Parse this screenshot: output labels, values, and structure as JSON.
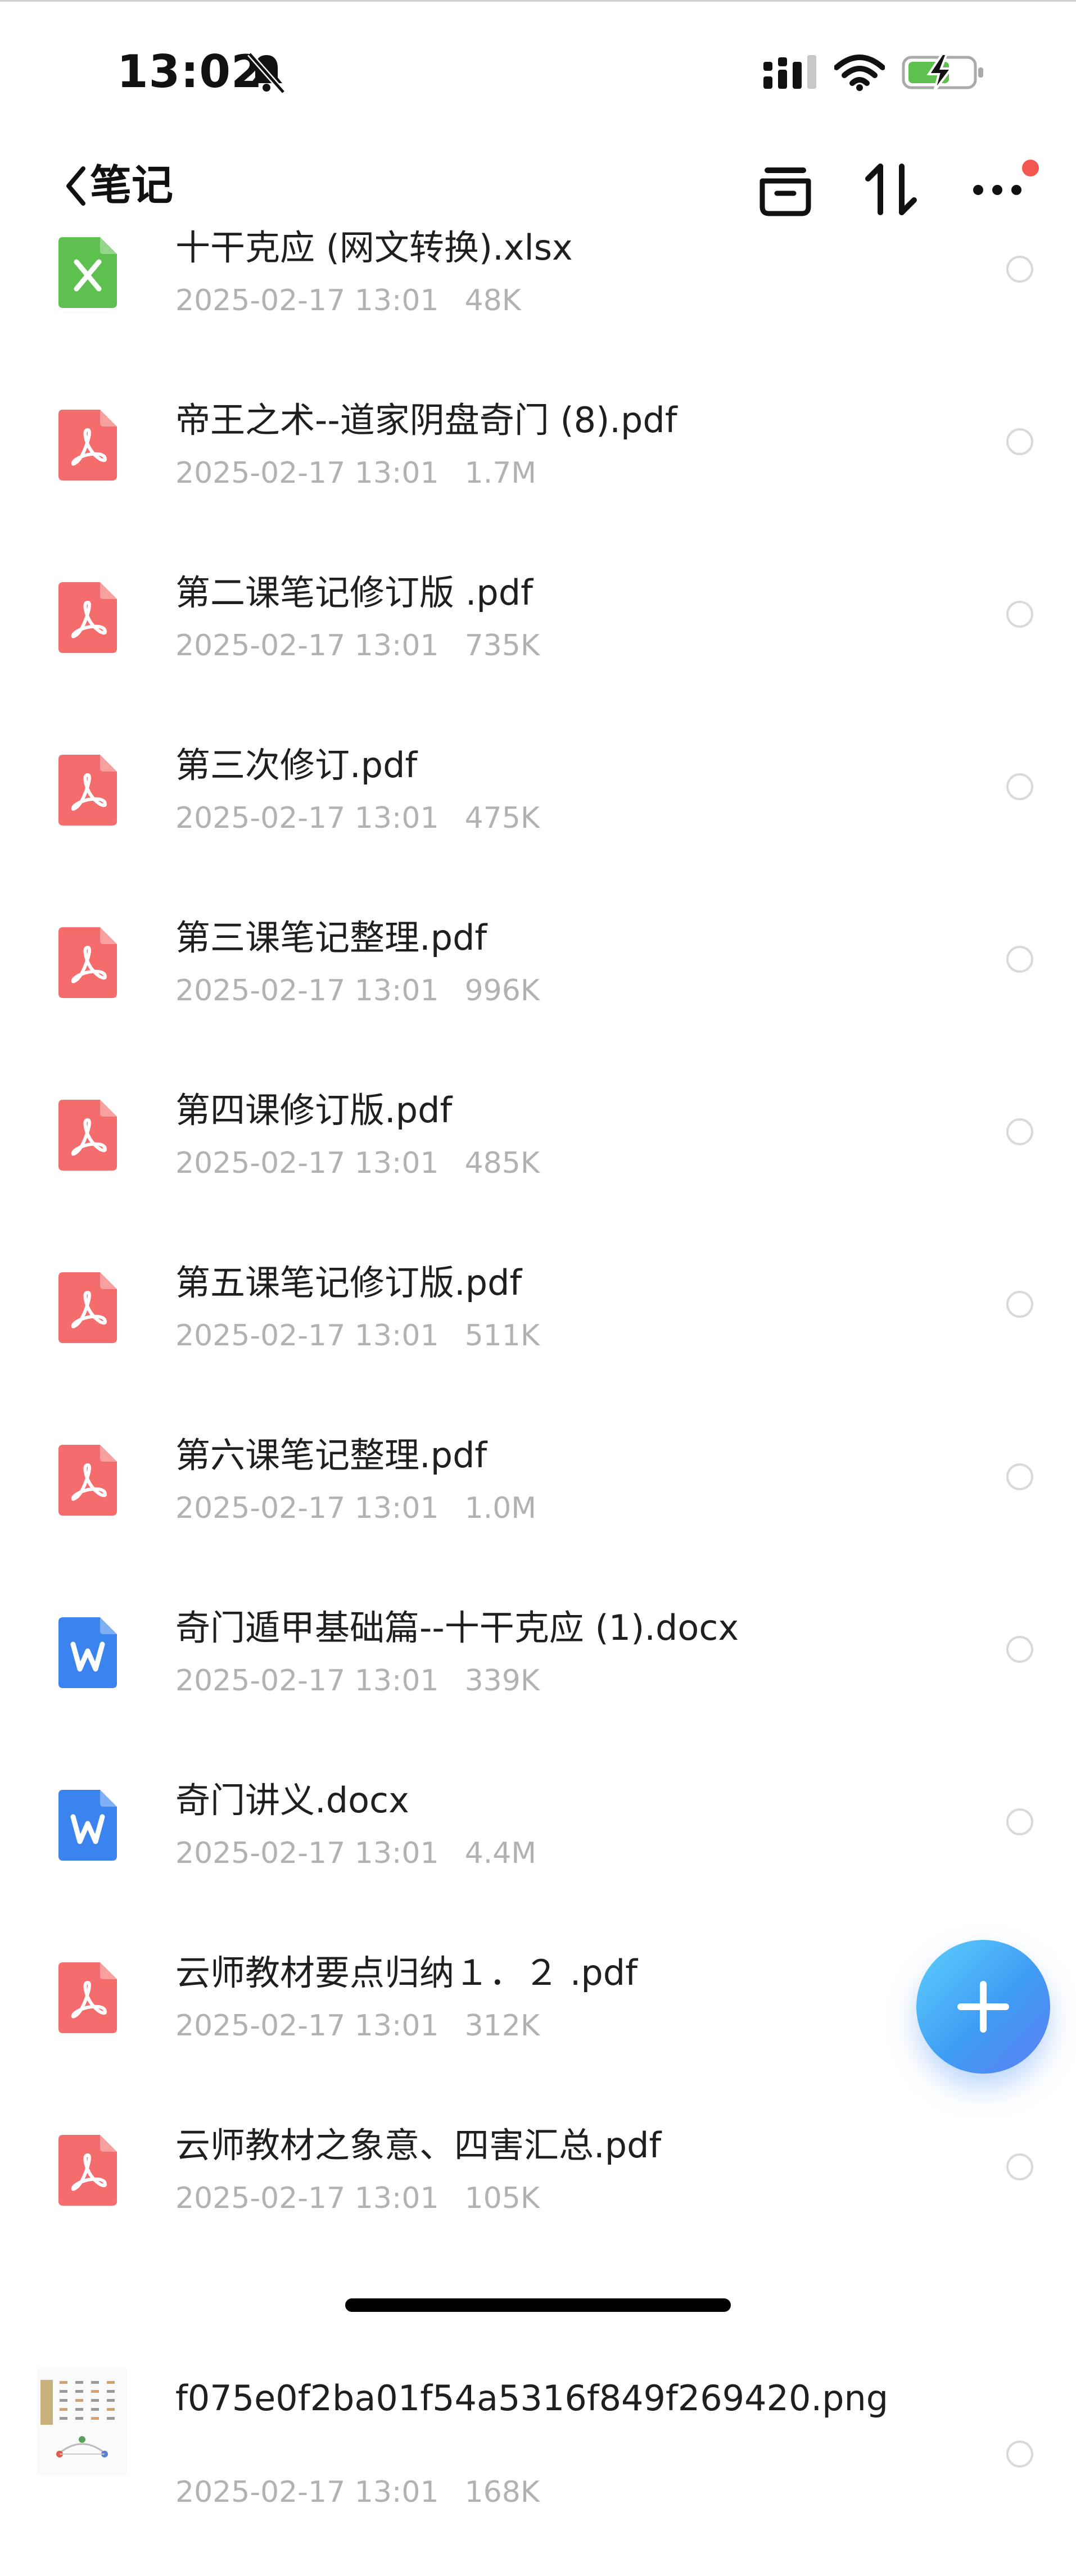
{
  "status_bar": {
    "time": "13:02"
  },
  "nav": {
    "title": "笔记"
  },
  "files": [
    {
      "name": "十干克应 (网文转换).xlsx",
      "date": "2025-02-17 13:01",
      "size": "48K",
      "type": "xlsx"
    },
    {
      "name": "帝王之术--道家阴盘奇门 (8).pdf",
      "date": "2025-02-17 13:01",
      "size": "1.7M",
      "type": "pdf"
    },
    {
      "name": "第二课笔记修订版 .pdf",
      "date": "2025-02-17 13:01",
      "size": "735K",
      "type": "pdf"
    },
    {
      "name": "第三次修订.pdf",
      "date": "2025-02-17 13:01",
      "size": "475K",
      "type": "pdf"
    },
    {
      "name": "第三课笔记整理.pdf",
      "date": "2025-02-17 13:01",
      "size": "996K",
      "type": "pdf"
    },
    {
      "name": "第四课修订版.pdf",
      "date": "2025-02-17 13:01",
      "size": "485K",
      "type": "pdf"
    },
    {
      "name": "第五课笔记修订版.pdf",
      "date": "2025-02-17 13:01",
      "size": "511K",
      "type": "pdf"
    },
    {
      "name": "第六课笔记整理.pdf",
      "date": "2025-02-17 13:01",
      "size": "1.0M",
      "type": "pdf"
    },
    {
      "name": "奇门遁甲基础篇--十干克应 (1).docx",
      "date": "2025-02-17 13:01",
      "size": "339K",
      "type": "docx"
    },
    {
      "name": "奇门讲义.docx",
      "date": "2025-02-17 13:01",
      "size": "4.4M",
      "type": "docx"
    },
    {
      "name": "云师教材要点归纳１．２ .pdf",
      "date": "2025-02-17 13:01",
      "size": "312K",
      "type": "pdf"
    },
    {
      "name": "云师教材之象意、四害汇总.pdf",
      "date": "2025-02-17 13:01",
      "size": "105K",
      "type": "pdf"
    },
    {
      "name": "f075e0f2ba01f54a5316f849f269420.png",
      "date": "2025-02-17 13:01",
      "size": "168K",
      "type": "png"
    }
  ],
  "icons": {
    "xlsx": "excel-file-icon",
    "pdf": "pdf-file-icon",
    "docx": "word-file-icon",
    "png": "image-thumbnail"
  },
  "colors": {
    "xlsx": "#5ec04f",
    "pdf": "#f56c6c",
    "docx": "#3b84f0",
    "accent": "#3f9cf5",
    "notification": "#f2584f"
  }
}
